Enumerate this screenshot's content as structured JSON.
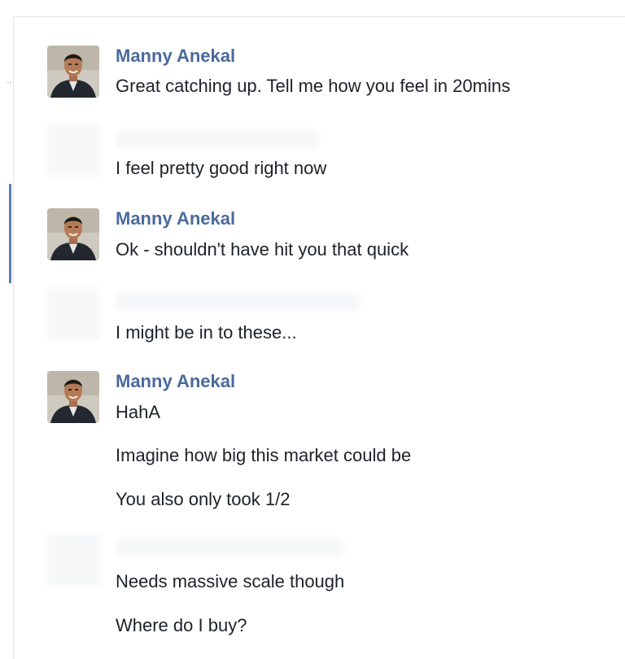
{
  "conversation": {
    "groups": [
      {
        "sender": "Manny Anekal",
        "messages": [
          "Great catching up. Tell me how you feel in 20mins"
        ]
      },
      {
        "sender": "",
        "messages": [
          "I feel pretty good right now"
        ]
      },
      {
        "sender": "Manny Anekal",
        "messages": [
          "Ok - shouldn't have hit you that quick"
        ]
      },
      {
        "sender": "",
        "messages": [
          "I might be in to these..."
        ]
      },
      {
        "sender": "Manny Anekal",
        "messages": [
          "HahA",
          "Imagine how big this market could be",
          "You also only took 1/2"
        ]
      },
      {
        "sender": "",
        "messages": [
          "Needs massive scale though",
          "Where do I buy?"
        ]
      }
    ]
  },
  "colors": {
    "sender_name": "#4b6a9b",
    "message_text": "#1d2129",
    "active_marker": "#5b7fb5"
  },
  "icons": {
    "avatar": "profile-photo"
  }
}
